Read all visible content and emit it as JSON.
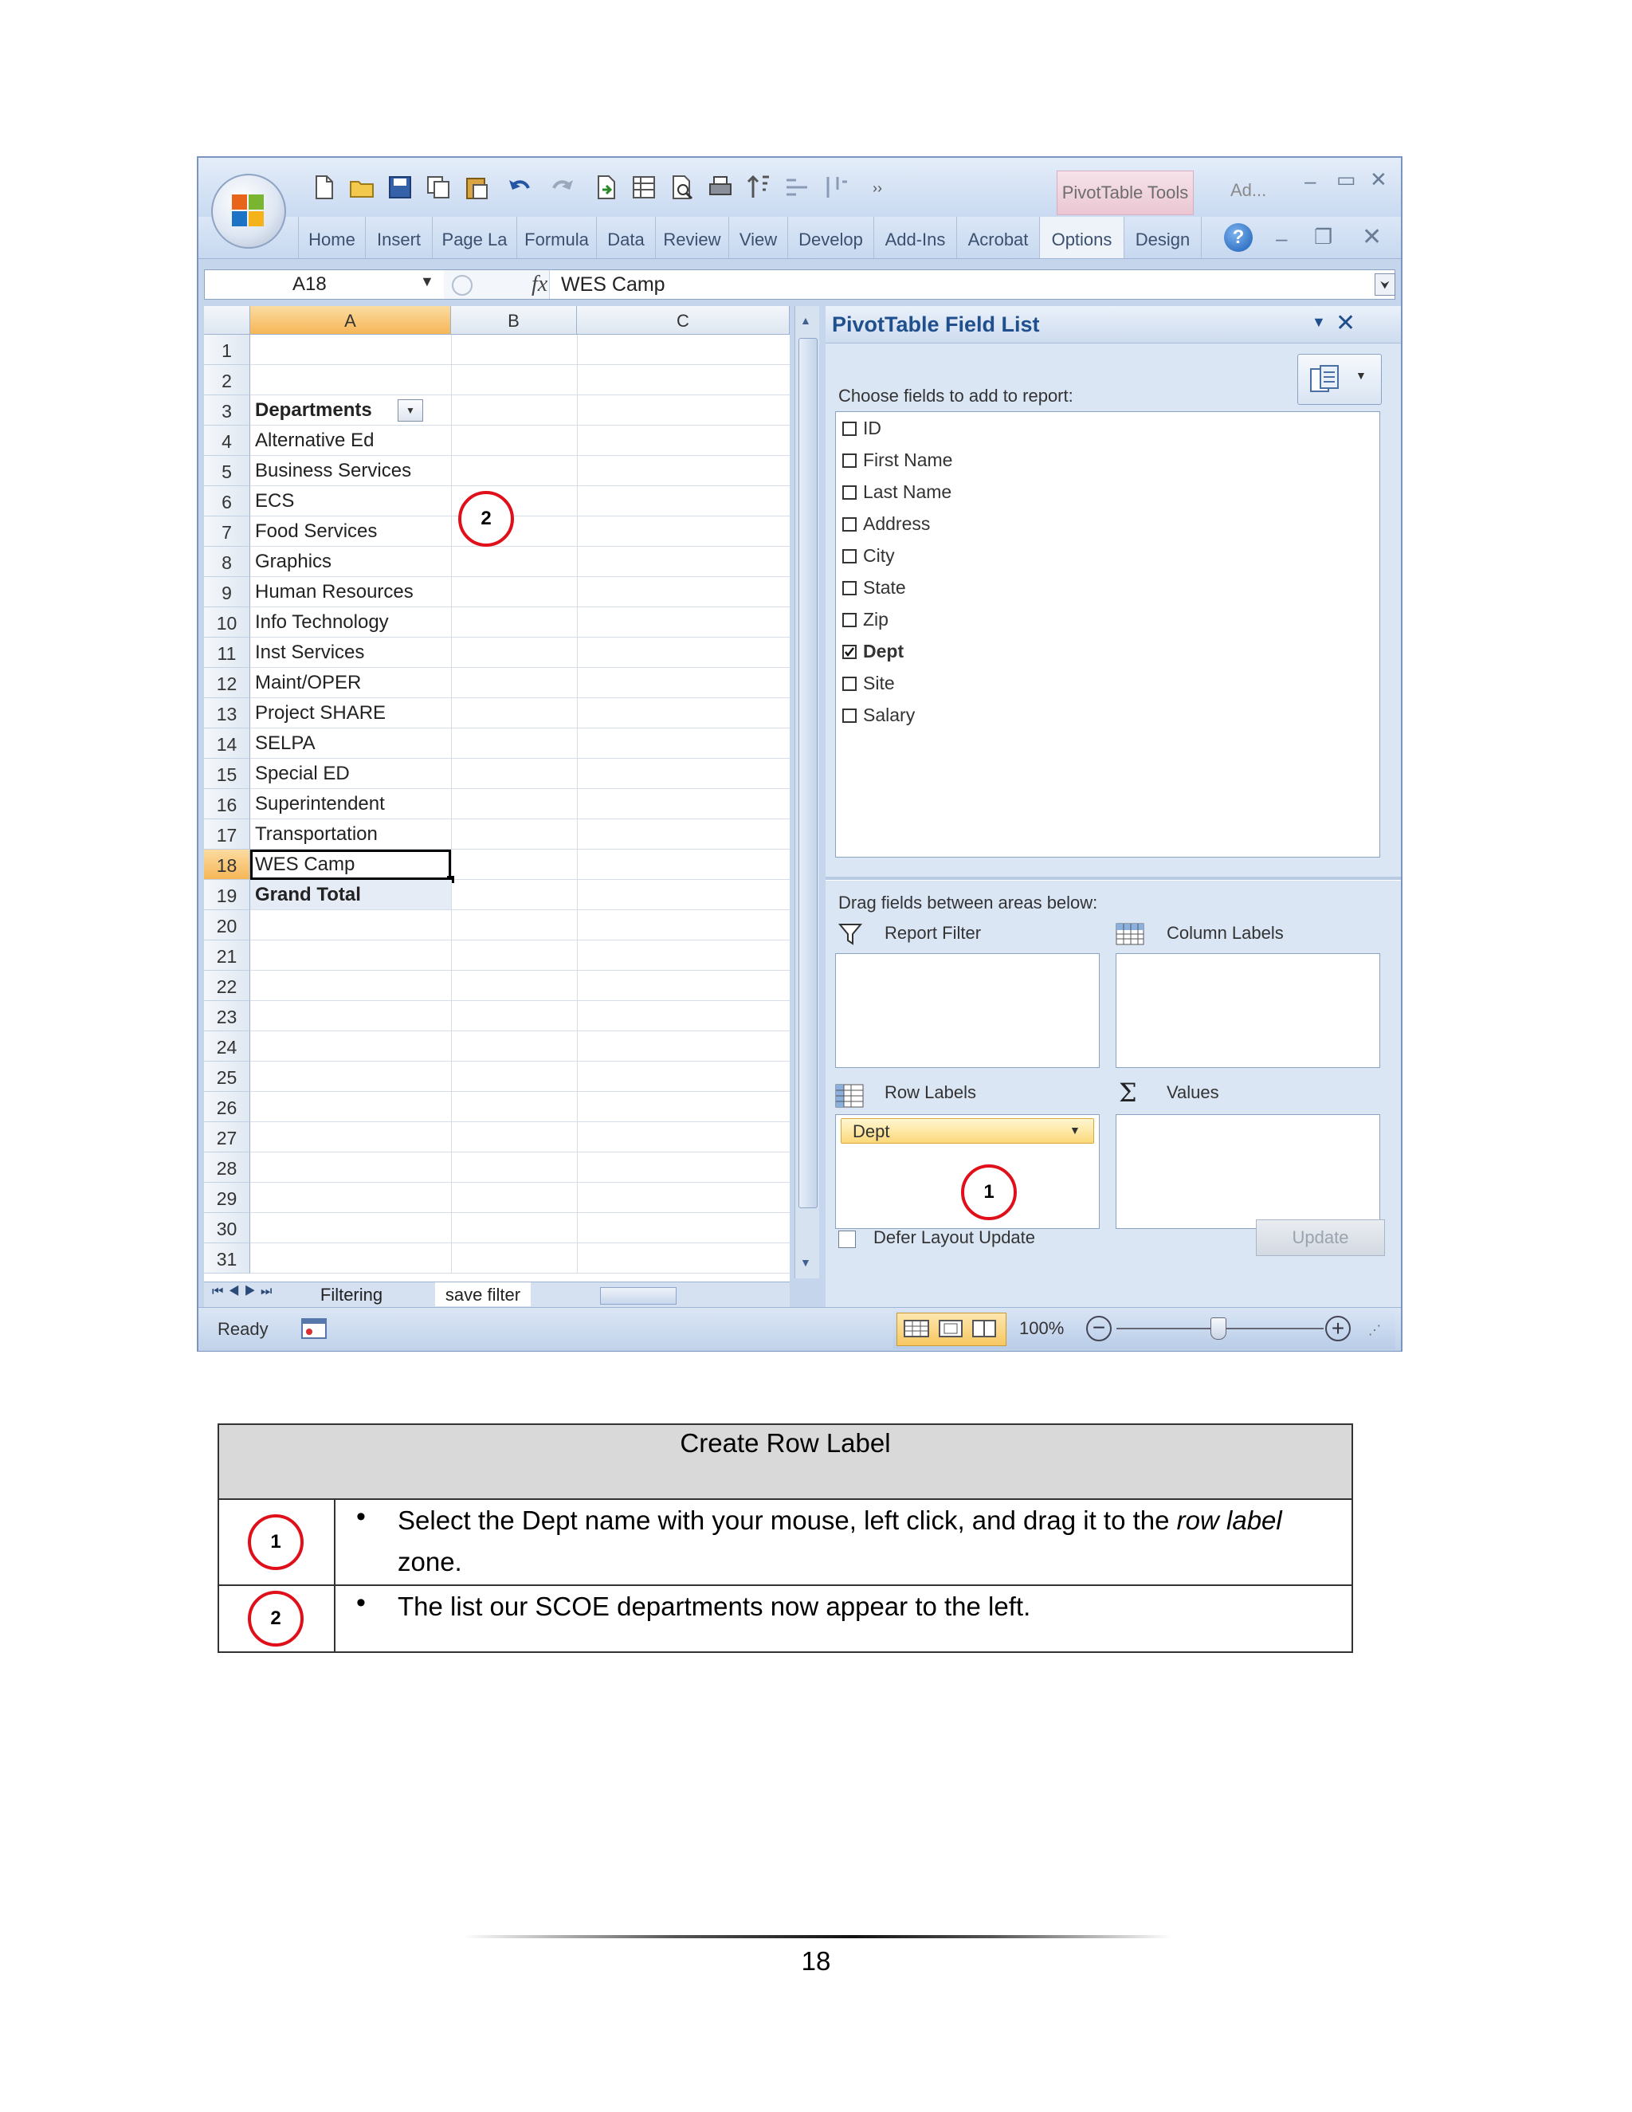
{
  "ribbon": {
    "tabs": [
      "Home",
      "Insert",
      "Page La",
      "Formula",
      "Data",
      "Review",
      "View",
      "Develop",
      "Add-Ins",
      "Acrobat",
      "Options",
      "Design"
    ],
    "context_tab": "PivotTable Tools",
    "app_title_short": "Ad..."
  },
  "formula_bar": {
    "name_box": "A18",
    "fx_label": "fx",
    "value": "WES Camp"
  },
  "grid": {
    "columns": [
      "A",
      "B",
      "C"
    ],
    "rows": [
      {
        "num": "1",
        "a": ""
      },
      {
        "num": "2",
        "a": ""
      },
      {
        "num": "3",
        "a": "Departments"
      },
      {
        "num": "4",
        "a": "Alternative Ed"
      },
      {
        "num": "5",
        "a": "Business Services"
      },
      {
        "num": "6",
        "a": "ECS"
      },
      {
        "num": "7",
        "a": "Food Services"
      },
      {
        "num": "8",
        "a": "Graphics"
      },
      {
        "num": "9",
        "a": "Human Resources"
      },
      {
        "num": "10",
        "a": "Info Technology"
      },
      {
        "num": "11",
        "a": "Inst Services"
      },
      {
        "num": "12",
        "a": "Maint/OPER"
      },
      {
        "num": "13",
        "a": "Project SHARE"
      },
      {
        "num": "14",
        "a": "SELPA"
      },
      {
        "num": "15",
        "a": "Special ED"
      },
      {
        "num": "16",
        "a": "Superintendent"
      },
      {
        "num": "17",
        "a": "Transportation"
      },
      {
        "num": "18",
        "a": "WES Camp"
      },
      {
        "num": "19",
        "a": "Grand Total"
      },
      {
        "num": "20",
        "a": ""
      },
      {
        "num": "21",
        "a": ""
      },
      {
        "num": "22",
        "a": ""
      },
      {
        "num": "23",
        "a": ""
      },
      {
        "num": "24",
        "a": ""
      },
      {
        "num": "25",
        "a": ""
      },
      {
        "num": "26",
        "a": ""
      },
      {
        "num": "27",
        "a": ""
      },
      {
        "num": "28",
        "a": ""
      },
      {
        "num": "29",
        "a": ""
      },
      {
        "num": "30",
        "a": ""
      },
      {
        "num": "31",
        "a": ""
      }
    ]
  },
  "sheet_tabs": {
    "tab1": "Filtering",
    "tab2": "save filter"
  },
  "status_bar": {
    "ready": "Ready",
    "zoom": "100%"
  },
  "pivot_panel": {
    "title": "PivotTable Field List",
    "choose_label": "Choose fields to add to report:",
    "fields": [
      {
        "name": "ID",
        "checked": false
      },
      {
        "name": "First Name",
        "checked": false
      },
      {
        "name": "Last Name",
        "checked": false
      },
      {
        "name": "Address",
        "checked": false
      },
      {
        "name": "City",
        "checked": false
      },
      {
        "name": "State",
        "checked": false
      },
      {
        "name": "Zip",
        "checked": false
      },
      {
        "name": "Dept",
        "checked": true
      },
      {
        "name": "Site",
        "checked": false
      },
      {
        "name": "Salary",
        "checked": false
      }
    ],
    "drag_label": "Drag fields between areas below:",
    "report_filter": "Report Filter",
    "column_labels": "Column Labels",
    "row_labels": "Row Labels",
    "values": "Values",
    "row_field": "Dept",
    "defer_label": "Defer Layout Update",
    "update_label": "Update"
  },
  "callouts": {
    "one": "1",
    "two": "2"
  },
  "instructions": {
    "title": "Create Row Label",
    "steps": [
      {
        "num": "1",
        "text_before": "Select the Dept name with your mouse, left click, and drag it to the ",
        "text_em": "row label",
        "text_after": " zone."
      },
      {
        "num": "2",
        "text": "The list our SCOE departments now appear to the left."
      }
    ]
  },
  "footer": {
    "page_number": "18"
  },
  "colors": {
    "callout_red": "#e0101a",
    "pivot_title": "#1f4f8c",
    "header_selected": "#f6b657"
  }
}
